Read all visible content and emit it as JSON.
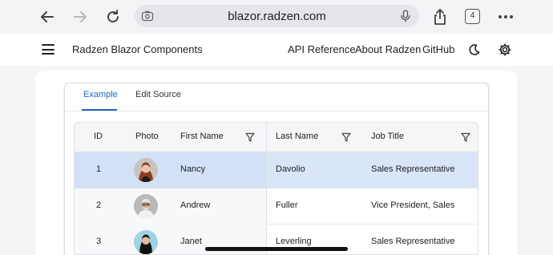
{
  "browser": {
    "url": "blazor.radzen.com",
    "tab_count": "4"
  },
  "header": {
    "title": "Radzen Blazor Components",
    "links": [
      "API Reference",
      "About Radzen",
      "GitHub"
    ]
  },
  "tabs": [
    {
      "label": "Example",
      "active": true
    },
    {
      "label": "Edit Source",
      "active": false
    }
  ],
  "grid": {
    "columns": [
      "ID",
      "Photo",
      "First Name",
      "Last Name",
      "Job Title"
    ],
    "rows": [
      {
        "id": "1",
        "first_name": "Nancy",
        "last_name": "Davolio",
        "job_title": "Sales Representative",
        "selected": true
      },
      {
        "id": "2",
        "first_name": "Andrew",
        "last_name": "Fuller",
        "job_title": "Vice President, Sales",
        "selected": false
      },
      {
        "id": "3",
        "first_name": "Janet",
        "last_name": "Leverling",
        "job_title": "Sales Representative",
        "selected": false
      }
    ]
  },
  "colors": {
    "accent": "#1e66c4",
    "selected_row": "#d9e6fa"
  }
}
